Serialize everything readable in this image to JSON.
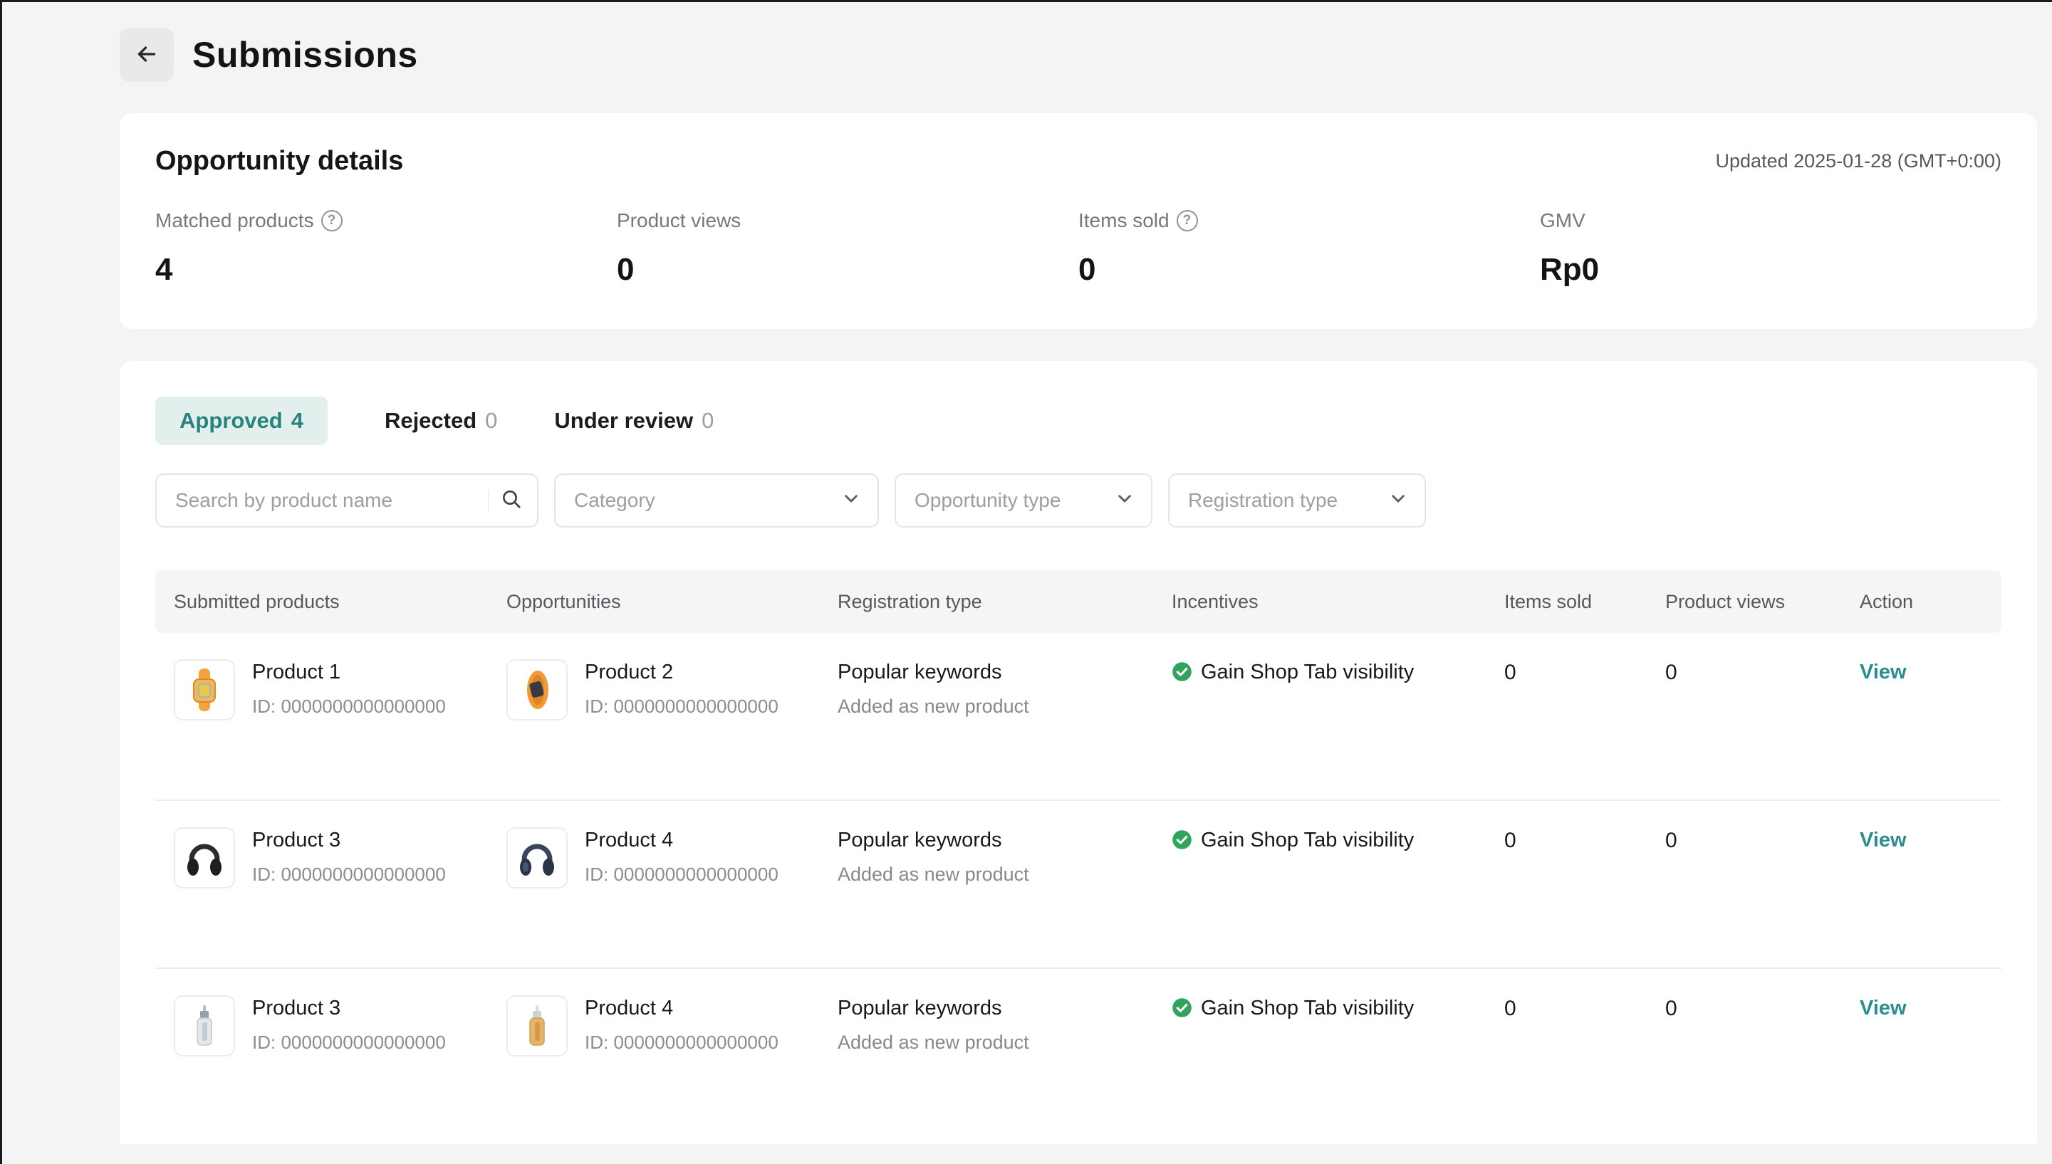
{
  "header": {
    "title": "Submissions"
  },
  "opportunity_details": {
    "title": "Opportunity details",
    "updated": "Updated 2025-01-28 (GMT+0:00)",
    "metrics": [
      {
        "label": "Matched products",
        "value": "4",
        "has_help": true
      },
      {
        "label": "Product views",
        "value": "0",
        "has_help": false
      },
      {
        "label": "Items sold",
        "value": "0",
        "has_help": true
      },
      {
        "label": "GMV",
        "value": "Rp0",
        "has_help": false
      }
    ]
  },
  "tabs": [
    {
      "label": "Approved",
      "count": "4",
      "active": true
    },
    {
      "label": "Rejected",
      "count": "0",
      "active": false
    },
    {
      "label": "Under review",
      "count": "0",
      "active": false
    }
  ],
  "filters": {
    "search_placeholder": "Search by product name",
    "search_icon": "magnifier-icon",
    "dropdowns": [
      {
        "label": "Category",
        "icon": "chevron-down-icon"
      },
      {
        "label": "Opportunity type",
        "icon": "chevron-down-icon"
      },
      {
        "label": "Registration type",
        "icon": "chevron-down-icon"
      }
    ]
  },
  "table": {
    "columns": [
      "Submitted products",
      "Opportunities",
      "Registration type",
      "Incentives",
      "Items sold",
      "Product views",
      "Action"
    ],
    "rows": [
      {
        "submitted": {
          "name": "Product 1",
          "id": "ID: 0000000000000000",
          "image": "watch-front-orange"
        },
        "opportunity": {
          "name": "Product 2",
          "id": "ID: 0000000000000000",
          "image": "watch-side-orange"
        },
        "registration_type": "Popular keywords",
        "registration_sub": "Added as new product",
        "incentive": "Gain Shop Tab visibility",
        "incentive_icon": "check-circle-icon",
        "items_sold": "0",
        "product_views": "0",
        "action": "View"
      },
      {
        "submitted": {
          "name": "Product 3",
          "id": "ID: 0000000000000000",
          "image": "headphones-black"
        },
        "opportunity": {
          "name": "Product 4",
          "id": "ID: 0000000000000000",
          "image": "headphones-navy"
        },
        "registration_type": "Popular keywords",
        "registration_sub": "Added as new product",
        "incentive": "Gain Shop Tab visibility",
        "incentive_icon": "check-circle-icon",
        "items_sold": "0",
        "product_views": "0",
        "action": "View"
      },
      {
        "submitted": {
          "name": "Product 3",
          "id": "ID: 0000000000000000",
          "image": "serum-silver"
        },
        "opportunity": {
          "name": "Product 4",
          "id": "ID: 0000000000000000",
          "image": "serum-amber"
        },
        "registration_type": "Popular keywords",
        "registration_sub": "Added as new product",
        "incentive": "Gain Shop Tab visibility",
        "incentive_icon": "check-circle-icon",
        "items_sold": "0",
        "product_views": "0",
        "action": "View"
      }
    ]
  },
  "colors": {
    "page_background": "#f4f4f4",
    "card_background": "#ffffff",
    "accent_teal": "#27837c",
    "view_link_teal": "#2c8c90",
    "active_tab_background": "#e3efec",
    "success_green": "#31a45b",
    "header_row_background": "#f5f5f6",
    "muted_text": "#85888c"
  }
}
